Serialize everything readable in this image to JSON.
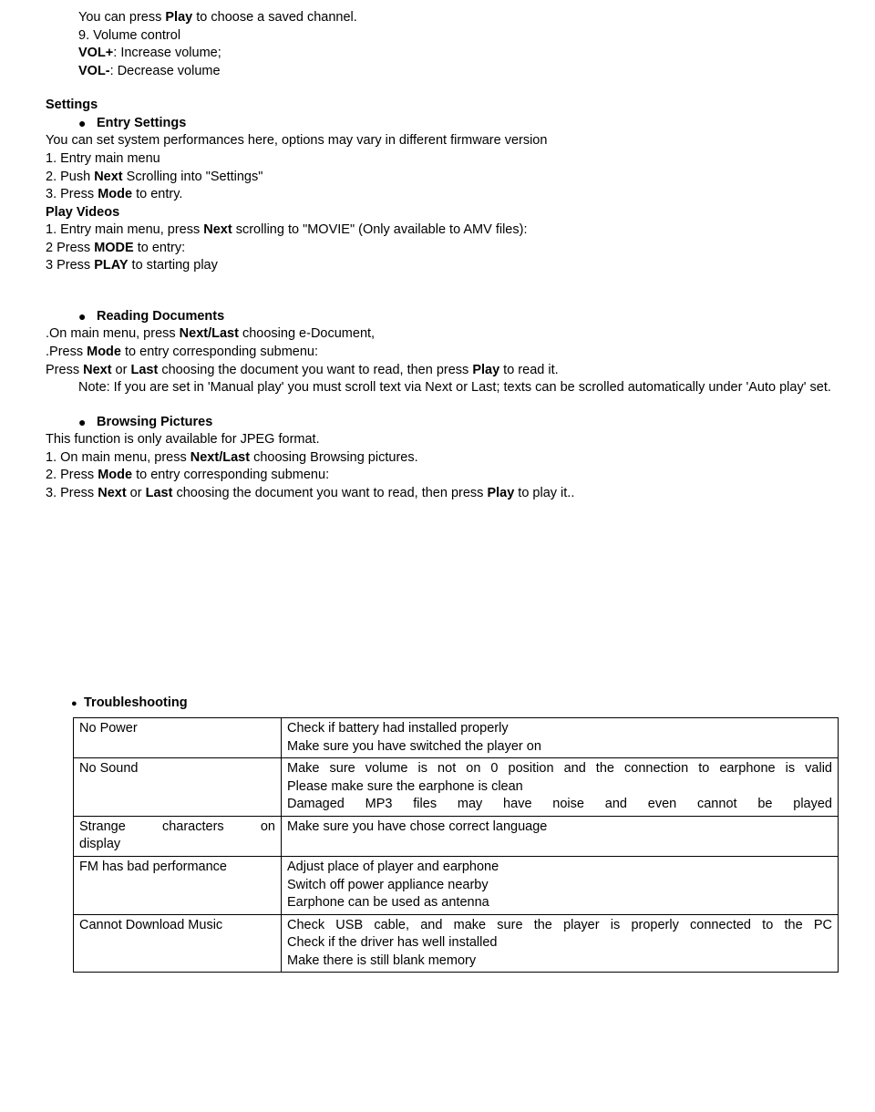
{
  "intro": {
    "line1_pre": "You can press ",
    "line1_b": "Play",
    "line1_post": " to choose a saved channel.",
    "line2": "9. Volume control",
    "line3_b": "VOL+",
    "line3_post": ": Increase volume;",
    "line4_b": "VOL-",
    "line4_post": ": Decrease volume"
  },
  "settings": {
    "heading": "Settings",
    "entry_settings": "Entry Settings",
    "es_desc": "You can set system performances here, options may vary in different firmware version",
    "es1": "1. Entry main menu",
    "es2_pre": "2. Push ",
    "es2_b": "Next",
    "es2_post": " Scrolling into \"Settings\"",
    "es3_pre": "3. Press ",
    "es3_b": "Mode",
    "es3_post": " to entry.",
    "play_videos": "Play Videos",
    "pv1_pre": "1. Entry main menu, press ",
    "pv1_b": "Next",
    "pv1_post": " scrolling to \"MOVIE\" (Only available to AMV files):",
    "pv2_pre": "2  Press ",
    "pv2_b": "MODE",
    "pv2_post": " to entry:",
    "pv3_pre": "3  Press ",
    "pv3_b": "PLAY",
    "pv3_post": " to starting play"
  },
  "reading": {
    "heading": "Reading Documents",
    "r1_pre": ".On main menu, press ",
    "r1_b": "Next/Last",
    "r1_post": " choosing e-Document,",
    "r2_pre": ".Press ",
    "r2_b": "Mode",
    "r2_post": " to entry corresponding submenu:",
    "r3_pre": " Press ",
    "r3_b1": "Next",
    "r3_mid": " or ",
    "r3_b2": "Last",
    "r3_mid2": " choosing the document you want to read, then press ",
    "r3_b3": "Play",
    "r3_post": " to read it.",
    "note": "Note: If you are set in 'Manual play' you must scroll text via Next or Last; texts can be scrolled automatically under 'Auto play' set."
  },
  "browsing": {
    "heading": "Browsing Pictures",
    "b0": "This function is only available for JPEG format.",
    "b1_pre": "1.  On main menu, press ",
    "b1_b": "Next/Last",
    "b1_post": " choosing Browsing pictures.",
    "b2_pre": "2.  Press ",
    "b2_b": "Mode",
    "b2_post": " to entry corresponding submenu:",
    "b3_pre": "3. Press ",
    "b3_b1": "Next",
    "b3_mid": " or ",
    "b3_b2": "Last",
    "b3_mid2": " choosing the document you want to read, then press ",
    "b3_b3": "Play",
    "b3_post": " to play it.."
  },
  "troubleshooting": {
    "heading": "Troubleshooting",
    "rows": [
      {
        "issue": "No Power",
        "fix": "Check if battery had installed properly\nMake sure you have switched the player on"
      },
      {
        "issue": "No Sound",
        "fix": "Make sure volume is not on 0 position and the connection to earphone is valid\nPlease make sure the earphone is clean\nDamaged MP3 files may have noise and even cannot be played"
      },
      {
        "issue": "Strange characters on display",
        "fix": "Make sure you have chose correct language"
      },
      {
        "issue": "FM has bad performance",
        "fix": "Adjust place of player and earphone\nSwitch off power appliance nearby\nEarphone can be used as antenna"
      },
      {
        "issue": "Cannot Download Music",
        "fix": "Check USB cable, and make sure the player is properly connected to the PC\nCheck if the driver has well installed\nMake there is still blank memory"
      }
    ]
  }
}
